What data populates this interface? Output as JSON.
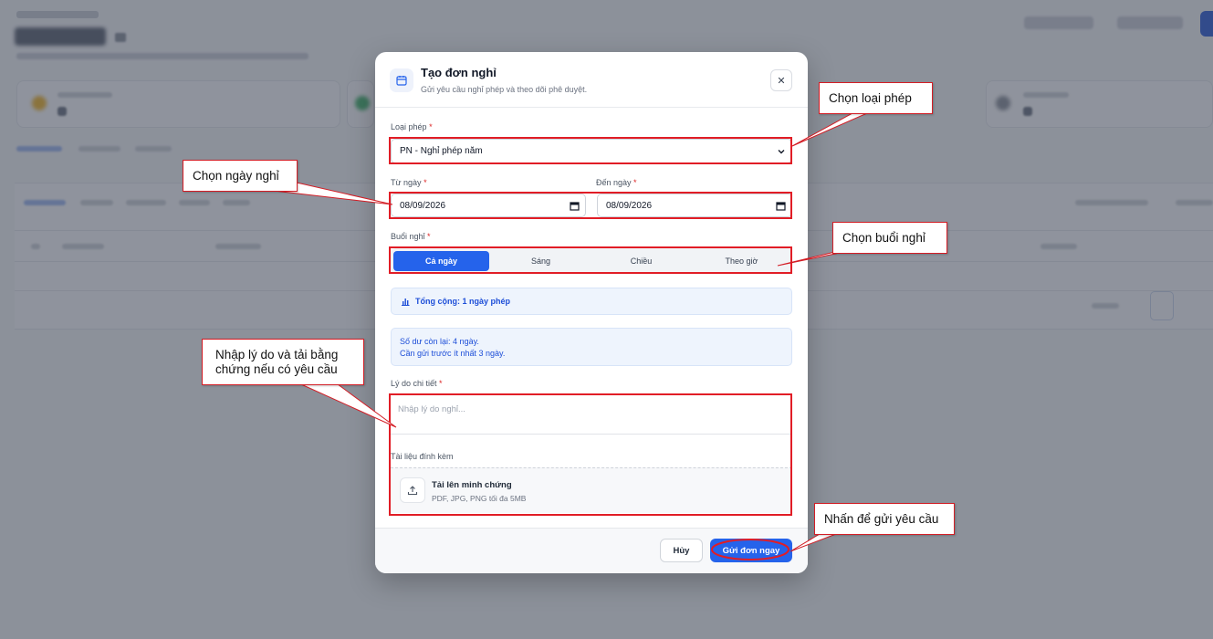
{
  "modal": {
    "title": "Tạo đơn nghỉ",
    "subtitle": "Gửi yêu cầu nghỉ phép và theo dõi phê duyệt.",
    "close_glyph": "✕",
    "leave_type": {
      "label": "Loại phép",
      "required_mark": "*",
      "value": "PN - Nghỉ phép năm"
    },
    "from_date": {
      "label": "Từ ngày",
      "required_mark": "*",
      "value": "08/09/2026"
    },
    "to_date": {
      "label": "Đến ngày",
      "required_mark": "*",
      "value": "08/09/2026"
    },
    "session": {
      "label": "Buổi nghỉ",
      "required_mark": "*",
      "options": [
        "Cả ngày",
        "Sáng",
        "Chiều",
        "Theo giờ"
      ],
      "selected": "Cả ngày"
    },
    "total": "Tổng cộng: 1 ngày phép",
    "balance_line1": "Số dư còn lại: 4 ngày.",
    "balance_line2": "Cần gửi trước ít nhất 3 ngày.",
    "reason": {
      "label": "Lý do chi tiết",
      "required_mark": "*",
      "placeholder": "Nhập lý do nghỉ..."
    },
    "attachment": {
      "label": "Tài liệu đính kèm",
      "title": "Tải lên minh chứng",
      "hint": "PDF, JPG, PNG tối đa 5MB"
    },
    "cancel_label": "Hủy",
    "submit_label": "Gửi đơn ngay"
  },
  "callouts": {
    "leave_type": "Chọn loại phép",
    "dates": "Chọn ngày nghỉ",
    "session": "Chọn buổi nghỉ",
    "reason_line1": "Nhập lý do và tải bằng",
    "reason_line2": "chứng nếu có yêu cầu",
    "submit": "Nhấn để gửi yêu cầu"
  },
  "colors": {
    "accent": "#2563eb",
    "highlight": "#e11d26",
    "required": "#dc2626"
  }
}
